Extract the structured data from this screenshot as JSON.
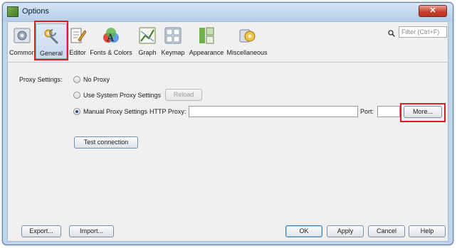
{
  "window": {
    "title": "Options",
    "close_glyph": "✕"
  },
  "toolbar": {
    "categories": [
      {
        "label": "Common",
        "icon": "common-icon"
      },
      {
        "label": "General",
        "icon": "general-icon",
        "selected": true
      },
      {
        "label": "Editor",
        "icon": "editor-icon"
      },
      {
        "label": "Fonts & Colors",
        "icon": "fonts-colors-icon"
      },
      {
        "label": "Graph",
        "icon": "graph-icon"
      },
      {
        "label": "Keymap",
        "icon": "keymap-icon"
      },
      {
        "label": "Appearance",
        "icon": "appearance-icon"
      },
      {
        "label": "Miscellaneous",
        "icon": "miscellaneous-icon"
      }
    ],
    "filter_placeholder": "Filter (Ctrl+F)"
  },
  "proxy": {
    "label": "Proxy Settings:",
    "options": {
      "no_proxy": "No Proxy",
      "system_proxy": "Use System Proxy Settings",
      "manual_proxy": "Manual Proxy Settings"
    },
    "selected": "manual_proxy",
    "reload_label": "Reload",
    "http_proxy_label": "HTTP Proxy:",
    "http_proxy_value": "",
    "port_label": "Port:",
    "port_value": "",
    "more_label": "More...",
    "test_connection_label": "Test connection"
  },
  "footer": {
    "export_label": "Export...",
    "import_label": "Import...",
    "ok_label": "OK",
    "apply_label": "Apply",
    "cancel_label": "Cancel",
    "help_label": "Help"
  },
  "colors": {
    "window_frame": "#bfd4ea",
    "close_button": "#c8432f",
    "highlight_box": "#d81f26",
    "panel_bg": "#f0f0f0"
  }
}
